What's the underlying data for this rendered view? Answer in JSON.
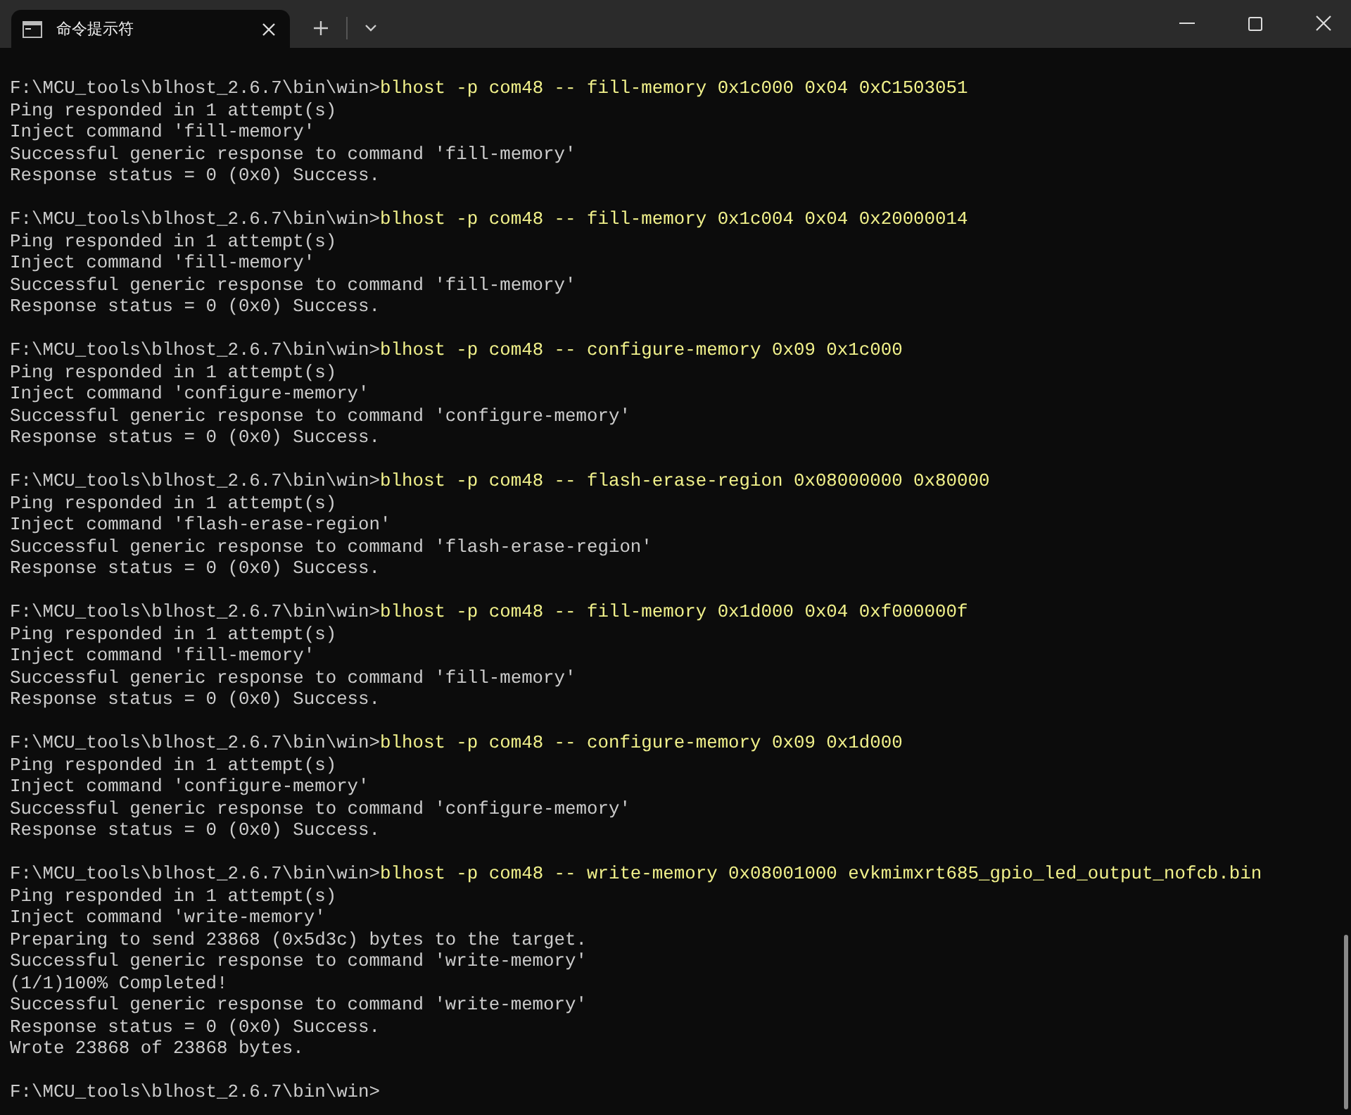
{
  "window": {
    "tab_title": "命令提示符"
  },
  "lines": [
    {
      "kind": "command",
      "prompt": "F:\\MCU_tools\\blhost_2.6.7\\bin\\win>",
      "command": "blhost -p com48 -- fill-memory 0x1c000 0x04 0xC1503051"
    },
    {
      "kind": "output",
      "text": "Ping responded in 1 attempt(s)"
    },
    {
      "kind": "output",
      "text": "Inject command 'fill-memory'"
    },
    {
      "kind": "output",
      "text": "Successful generic response to command 'fill-memory'"
    },
    {
      "kind": "output",
      "text": "Response status = 0 (0x0) Success."
    },
    {
      "kind": "blank"
    },
    {
      "kind": "command",
      "prompt": "F:\\MCU_tools\\blhost_2.6.7\\bin\\win>",
      "command": "blhost -p com48 -- fill-memory 0x1c004 0x04 0x20000014"
    },
    {
      "kind": "output",
      "text": "Ping responded in 1 attempt(s)"
    },
    {
      "kind": "output",
      "text": "Inject command 'fill-memory'"
    },
    {
      "kind": "output",
      "text": "Successful generic response to command 'fill-memory'"
    },
    {
      "kind": "output",
      "text": "Response status = 0 (0x0) Success."
    },
    {
      "kind": "blank"
    },
    {
      "kind": "command",
      "prompt": "F:\\MCU_tools\\blhost_2.6.7\\bin\\win>",
      "command": "blhost -p com48 -- configure-memory 0x09 0x1c000"
    },
    {
      "kind": "output",
      "text": "Ping responded in 1 attempt(s)"
    },
    {
      "kind": "output",
      "text": "Inject command 'configure-memory'"
    },
    {
      "kind": "output",
      "text": "Successful generic response to command 'configure-memory'"
    },
    {
      "kind": "output",
      "text": "Response status = 0 (0x0) Success."
    },
    {
      "kind": "blank"
    },
    {
      "kind": "command",
      "prompt": "F:\\MCU_tools\\blhost_2.6.7\\bin\\win>",
      "command": "blhost -p com48 -- flash-erase-region 0x08000000 0x80000"
    },
    {
      "kind": "output",
      "text": "Ping responded in 1 attempt(s)"
    },
    {
      "kind": "output",
      "text": "Inject command 'flash-erase-region'"
    },
    {
      "kind": "output",
      "text": "Successful generic response to command 'flash-erase-region'"
    },
    {
      "kind": "output",
      "text": "Response status = 0 (0x0) Success."
    },
    {
      "kind": "blank"
    },
    {
      "kind": "command",
      "prompt": "F:\\MCU_tools\\blhost_2.6.7\\bin\\win>",
      "command": "blhost -p com48 -- fill-memory 0x1d000 0x04 0xf000000f"
    },
    {
      "kind": "output",
      "text": "Ping responded in 1 attempt(s)"
    },
    {
      "kind": "output",
      "text": "Inject command 'fill-memory'"
    },
    {
      "kind": "output",
      "text": "Successful generic response to command 'fill-memory'"
    },
    {
      "kind": "output",
      "text": "Response status = 0 (0x0) Success."
    },
    {
      "kind": "blank"
    },
    {
      "kind": "command",
      "prompt": "F:\\MCU_tools\\blhost_2.6.7\\bin\\win>",
      "command": "blhost -p com48 -- configure-memory 0x09 0x1d000"
    },
    {
      "kind": "output",
      "text": "Ping responded in 1 attempt(s)"
    },
    {
      "kind": "output",
      "text": "Inject command 'configure-memory'"
    },
    {
      "kind": "output",
      "text": "Successful generic response to command 'configure-memory'"
    },
    {
      "kind": "output",
      "text": "Response status = 0 (0x0) Success."
    },
    {
      "kind": "blank"
    },
    {
      "kind": "command",
      "prompt": "F:\\MCU_tools\\blhost_2.6.7\\bin\\win>",
      "command": "blhost -p com48 -- write-memory 0x08001000 evkmimxrt685_gpio_led_output_nofcb.bin"
    },
    {
      "kind": "output",
      "text": "Ping responded in 1 attempt(s)"
    },
    {
      "kind": "output",
      "text": "Inject command 'write-memory'"
    },
    {
      "kind": "output",
      "text": "Preparing to send 23868 (0x5d3c) bytes to the target."
    },
    {
      "kind": "output",
      "text": "Successful generic response to command 'write-memory'"
    },
    {
      "kind": "output",
      "text": "(1/1)100% Completed!"
    },
    {
      "kind": "output",
      "text": "Successful generic response to command 'write-memory'"
    },
    {
      "kind": "output",
      "text": "Response status = 0 (0x0) Success."
    },
    {
      "kind": "output",
      "text": "Wrote 23868 of 23868 bytes."
    },
    {
      "kind": "blank"
    },
    {
      "kind": "prompt",
      "prompt": "F:\\MCU_tools\\blhost_2.6.7\\bin\\win>"
    }
  ]
}
